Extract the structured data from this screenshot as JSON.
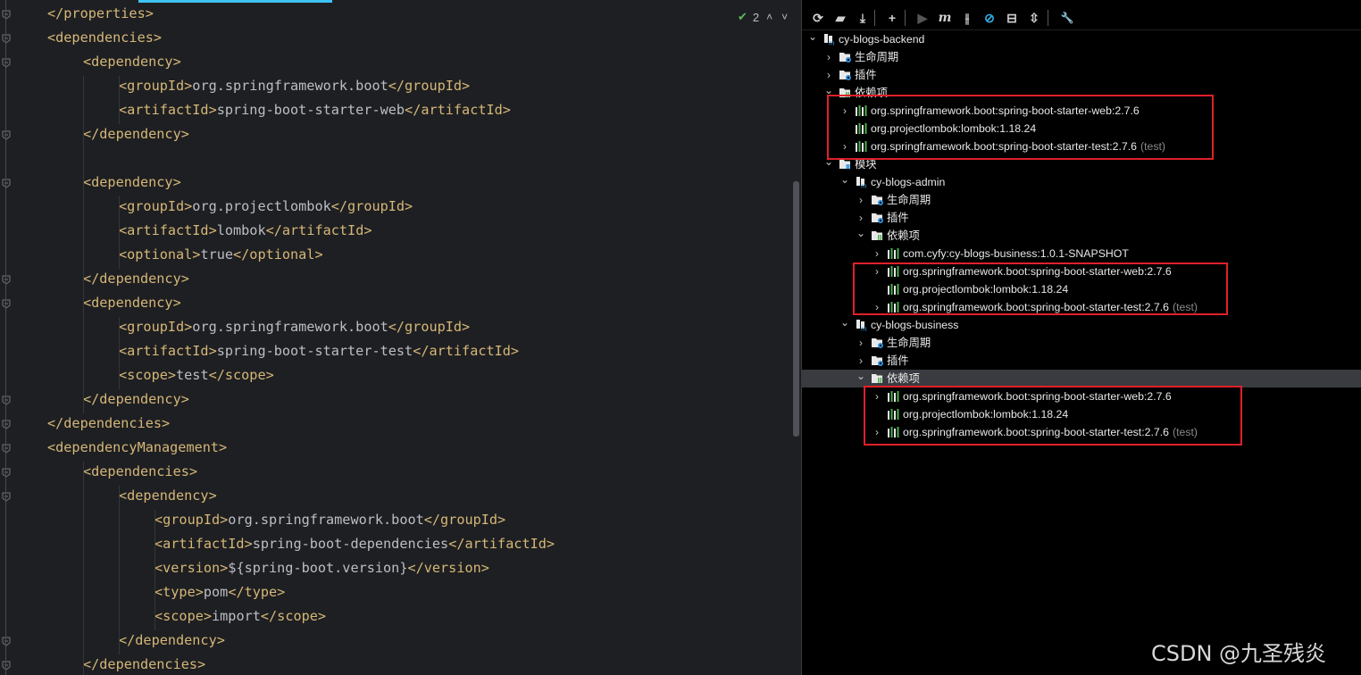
{
  "editor": {
    "inspection": {
      "count": "2",
      "up": "˄",
      "down": "˅"
    },
    "lines": [
      {
        "open": "</properties>",
        "text": "",
        "close": ""
      },
      {
        "open": "<dependencies>",
        "text": "",
        "close": ""
      },
      {
        "open": "<dependency>",
        "text": "",
        "close": ""
      },
      {
        "open": "<groupId>",
        "text": "org.springframework.boot",
        "close": "</groupId>"
      },
      {
        "open": "<artifactId>",
        "text": "spring-boot-starter-web",
        "close": "</artifactId>"
      },
      {
        "open": "</dependency>",
        "text": "",
        "close": ""
      },
      {
        "open": "",
        "text": "",
        "close": ""
      },
      {
        "open": "<dependency>",
        "text": "",
        "close": ""
      },
      {
        "open": "<groupId>",
        "text": "org.projectlombok",
        "close": "</groupId>"
      },
      {
        "open": "<artifactId>",
        "text": "lombok",
        "close": "</artifactId>"
      },
      {
        "open": "<optional>",
        "text": "true",
        "close": "</optional>"
      },
      {
        "open": "</dependency>",
        "text": "",
        "close": ""
      },
      {
        "open": "<dependency>",
        "text": "",
        "close": ""
      },
      {
        "open": "<groupId>",
        "text": "org.springframework.boot",
        "close": "</groupId>"
      },
      {
        "open": "<artifactId>",
        "text": "spring-boot-starter-test",
        "close": "</artifactId>"
      },
      {
        "open": "<scope>",
        "text": "test",
        "close": "</scope>"
      },
      {
        "open": "</dependency>",
        "text": "",
        "close": ""
      },
      {
        "open": "</dependencies>",
        "text": "",
        "close": ""
      },
      {
        "open": "<dependencyManagement>",
        "text": "",
        "close": ""
      },
      {
        "open": "<dependencies>",
        "text": "",
        "close": ""
      },
      {
        "open": "<dependency>",
        "text": "",
        "close": ""
      },
      {
        "open": "<groupId>",
        "text": "org.springframework.boot",
        "close": "</groupId>"
      },
      {
        "open": "<artifactId>",
        "text": "spring-boot-dependencies",
        "close": "</artifactId>"
      },
      {
        "open": "<version>",
        "text": "${spring-boot.version}",
        "close": "</version>"
      },
      {
        "open": "<type>",
        "text": "pom",
        "close": "</type>"
      },
      {
        "open": "<scope>",
        "text": "import",
        "close": "</scope>"
      },
      {
        "open": "</dependency>",
        "text": "",
        "close": ""
      },
      {
        "open": "</dependencies>",
        "text": "",
        "close": ""
      }
    ]
  },
  "maven": {
    "toolbar": [
      "refresh-icon",
      "reimport-folder-icon",
      "download-icon",
      "add-icon",
      "run-icon",
      "maven-goal-icon",
      "toggle-offline-icon",
      "skip-tests-icon",
      "show-dependencies-icon",
      "collapse-all-icon",
      "settings-wrench-icon"
    ],
    "tree": [
      {
        "level": 0,
        "chev": "v",
        "icon": "module",
        "label": "cy-blogs-backend",
        "scope": ""
      },
      {
        "level": 1,
        "chev": ">",
        "icon": "folder-gear",
        "label": "生命周期",
        "scope": ""
      },
      {
        "level": 1,
        "chev": ">",
        "icon": "folder-gear",
        "label": "插件",
        "scope": ""
      },
      {
        "level": 1,
        "chev": "v",
        "icon": "folder-lib",
        "label": "依赖项",
        "scope": ""
      },
      {
        "level": 2,
        "chev": ">",
        "icon": "lib",
        "label": "org.springframework.boot:spring-boot-starter-web:2.7.6",
        "scope": ""
      },
      {
        "level": 2,
        "chev": "",
        "icon": "lib",
        "label": "org.projectlombok:lombok:1.18.24",
        "scope": ""
      },
      {
        "level": 2,
        "chev": ">",
        "icon": "lib",
        "label": "org.springframework.boot:spring-boot-starter-test:2.7.6",
        "scope": "(test)"
      },
      {
        "level": 1,
        "chev": "v",
        "icon": "folder-module",
        "label": "模块",
        "scope": ""
      },
      {
        "level": 2,
        "chev": "v",
        "icon": "module",
        "label": "cy-blogs-admin",
        "scope": ""
      },
      {
        "level": 3,
        "chev": ">",
        "icon": "folder-gear",
        "label": "生命周期",
        "scope": ""
      },
      {
        "level": 3,
        "chev": ">",
        "icon": "folder-gear",
        "label": "插件",
        "scope": ""
      },
      {
        "level": 3,
        "chev": "v",
        "icon": "folder-lib",
        "label": "依赖项",
        "scope": ""
      },
      {
        "level": 4,
        "chev": ">",
        "icon": "lib",
        "label": "com.cyfy:cy-blogs-business:1.0.1-SNAPSHOT",
        "scope": ""
      },
      {
        "level": 4,
        "chev": ">",
        "icon": "lib",
        "label": "org.springframework.boot:spring-boot-starter-web:2.7.6",
        "scope": ""
      },
      {
        "level": 4,
        "chev": "",
        "icon": "lib",
        "label": "org.projectlombok:lombok:1.18.24",
        "scope": ""
      },
      {
        "level": 4,
        "chev": ">",
        "icon": "lib",
        "label": "org.springframework.boot:spring-boot-starter-test:2.7.6",
        "scope": "(test)"
      },
      {
        "level": 2,
        "chev": "v",
        "icon": "module",
        "label": "cy-blogs-business",
        "scope": ""
      },
      {
        "level": 3,
        "chev": ">",
        "icon": "folder-gear",
        "label": "生命周期",
        "scope": ""
      },
      {
        "level": 3,
        "chev": ">",
        "icon": "folder-gear",
        "label": "插件",
        "scope": ""
      },
      {
        "level": 3,
        "chev": "v",
        "icon": "folder-lib",
        "label": "依赖项",
        "scope": "",
        "selected": true
      },
      {
        "level": 4,
        "chev": ">",
        "icon": "lib",
        "label": "org.springframework.boot:spring-boot-starter-web:2.7.6",
        "scope": ""
      },
      {
        "level": 4,
        "chev": "",
        "icon": "lib",
        "label": "org.projectlombok:lombok:1.18.24",
        "scope": ""
      },
      {
        "level": 4,
        "chev": ">",
        "icon": "lib",
        "label": "org.springframework.boot:spring-boot-starter-test:2.7.6",
        "scope": "(test)"
      }
    ]
  },
  "colors": {
    "tag": "#d5b778",
    "text": "#bcbec4",
    "highlight": "#e0202a",
    "scrollbar_accent": "#3fc3f6"
  },
  "watermark": "CSDN @九圣残炎"
}
